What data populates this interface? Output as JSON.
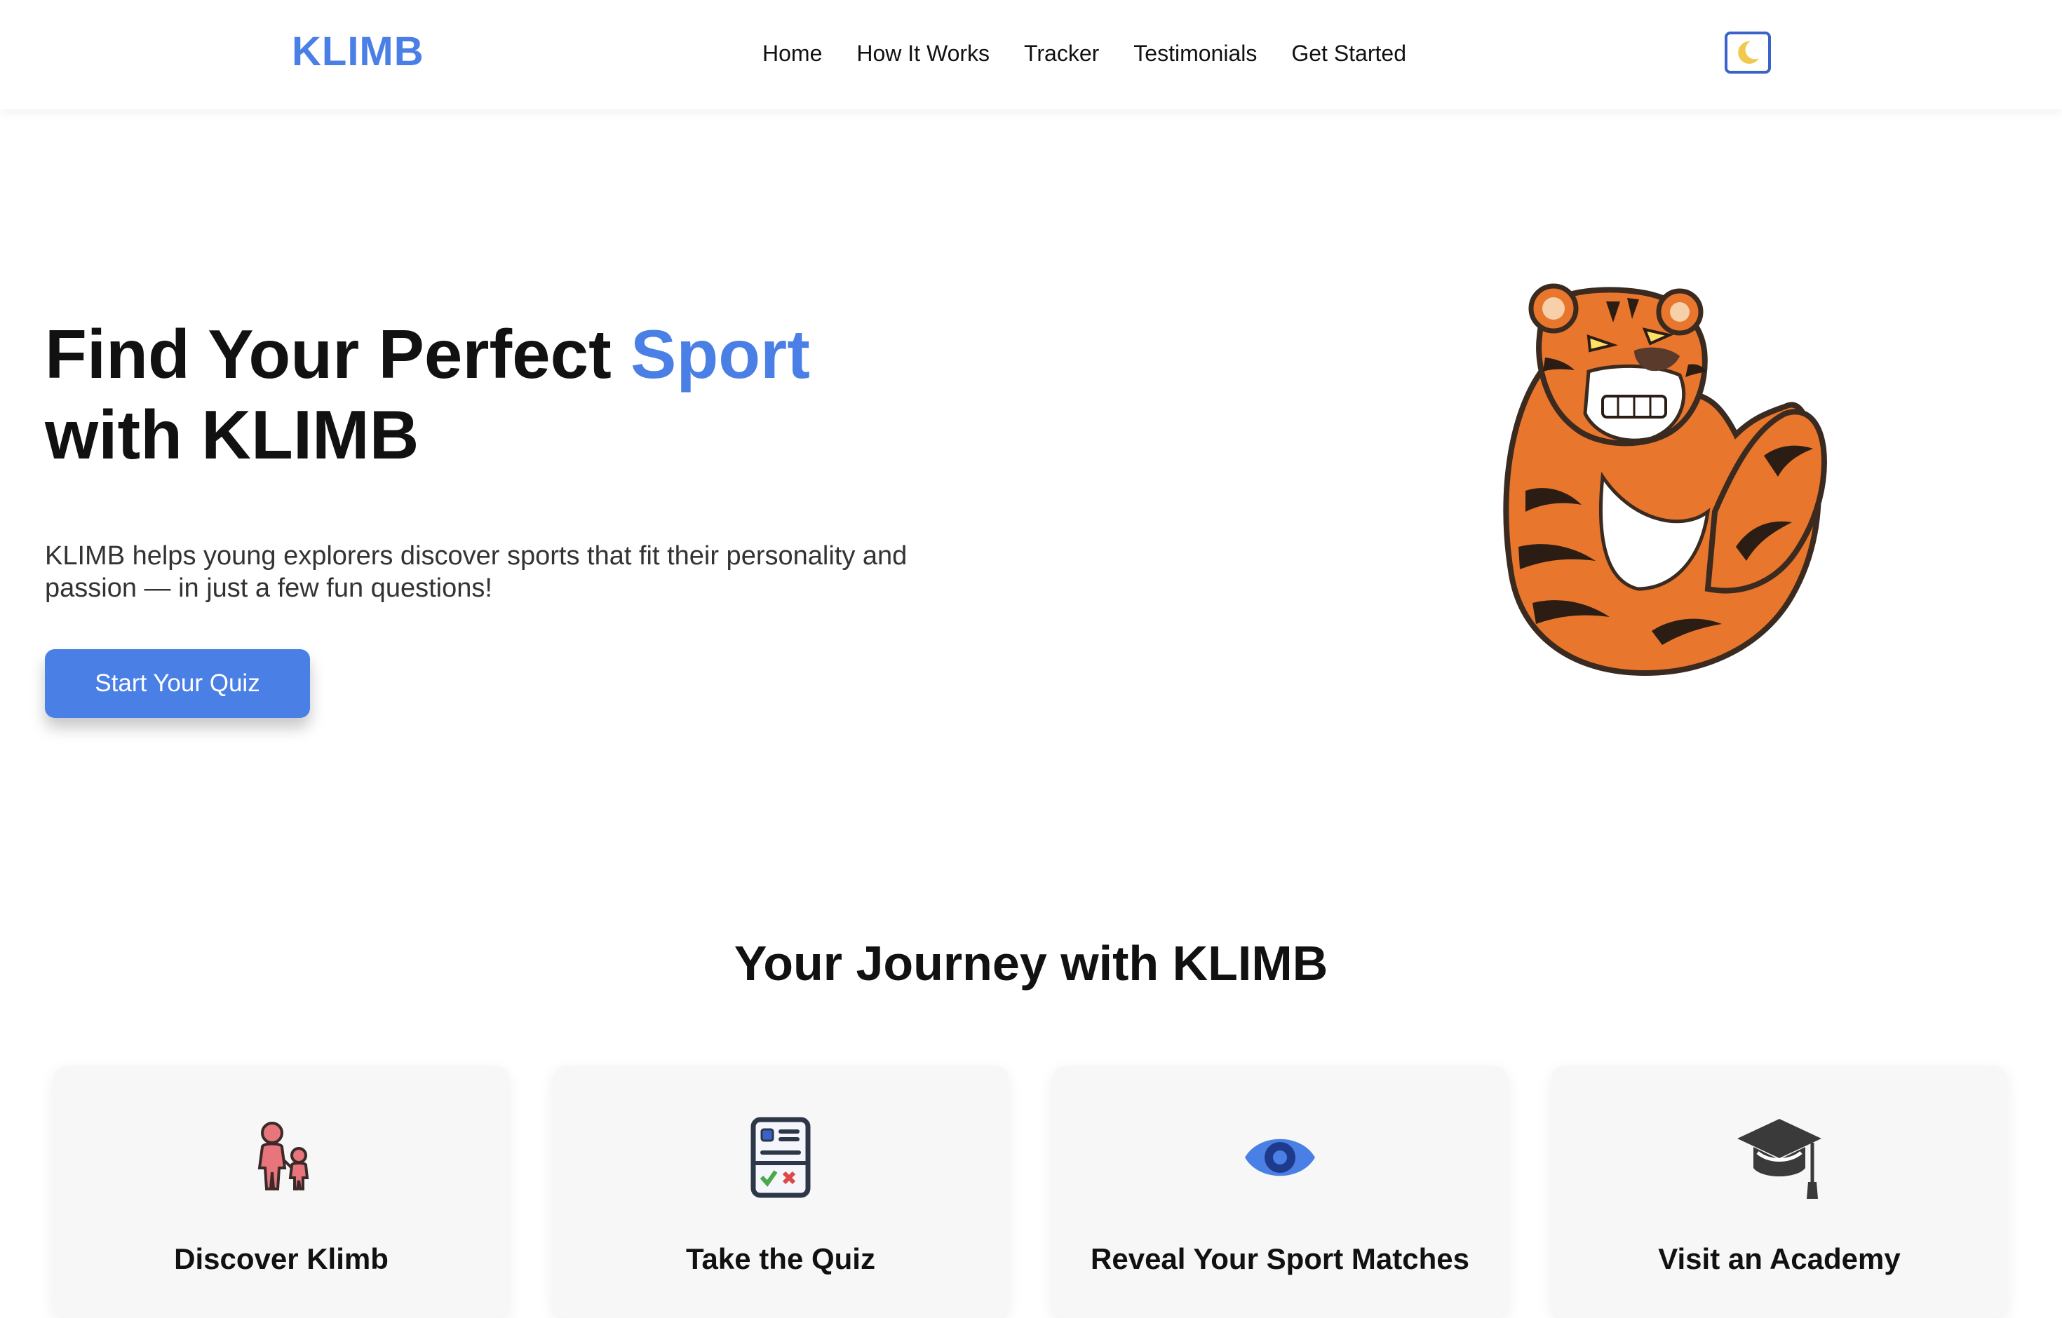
{
  "brand": {
    "logo": "KLIMB",
    "accent_color": "#4a7fe6"
  },
  "nav": {
    "links": [
      "Home",
      "How It Works",
      "Tracker",
      "Testimonials",
      "Get Started"
    ],
    "theme_toggle_icon": "moon-icon"
  },
  "hero": {
    "title_part1": "Find Your Perfect ",
    "title_accent": "Sport",
    "title_part2": "with KLIMB",
    "description": "KLIMB helps young explorers discover sports that fit their personality and passion — in just a few fun questions!",
    "cta_label": "Start Your Quiz",
    "mascot": "tiger-mascot-flexing"
  },
  "journey": {
    "title": "Your Journey with KLIMB",
    "steps": [
      {
        "title": "Discover Klimb",
        "icon": "parent-child-icon"
      },
      {
        "title": "Take the Quiz",
        "icon": "quiz-checklist-icon"
      },
      {
        "title": "Reveal Your Sport Matches",
        "icon": "eye-icon"
      },
      {
        "title": "Visit an Academy",
        "icon": "graduation-cap-icon"
      }
    ]
  }
}
